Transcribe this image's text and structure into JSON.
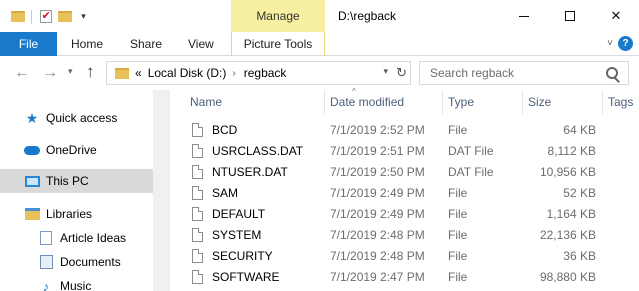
{
  "titlebar": {
    "manage_label": "Manage",
    "window_title": "D:\\regback",
    "minimize": "minimize-icon",
    "maximize": "maximize-icon",
    "close_glyph": "✕"
  },
  "ribbon": {
    "file": "File",
    "tabs": [
      "Home",
      "Share",
      "View"
    ],
    "picture_tools": "Picture Tools",
    "help_glyph": "?"
  },
  "navbar": {
    "path_parts": [
      "Local Disk (D:)",
      "regback"
    ],
    "overflow": "«",
    "search_placeholder": "Search regback"
  },
  "sidebar": {
    "items": [
      {
        "label": "Quick access",
        "icon": "star-icon"
      },
      {
        "label": "OneDrive",
        "icon": "cloud-icon"
      },
      {
        "label": "This PC",
        "icon": "computer-icon"
      },
      {
        "label": "Libraries",
        "icon": "library-icon"
      },
      {
        "label": "Article Ideas",
        "icon": "document-icon"
      },
      {
        "label": "Documents",
        "icon": "documents-icon"
      },
      {
        "label": "Music",
        "icon": "music-icon"
      }
    ]
  },
  "filelist": {
    "columns": [
      "Name",
      "Date modified",
      "Type",
      "Size",
      "Tags"
    ],
    "rows": [
      {
        "name": "BCD",
        "date": "7/1/2019 2:52 PM",
        "type": "File",
        "size": "64 KB"
      },
      {
        "name": "USRCLASS.DAT",
        "date": "7/1/2019 2:51 PM",
        "type": "DAT File",
        "size": "8,112 KB"
      },
      {
        "name": "NTUSER.DAT",
        "date": "7/1/2019 2:50 PM",
        "type": "DAT File",
        "size": "10,956 KB"
      },
      {
        "name": "SAM",
        "date": "7/1/2019 2:49 PM",
        "type": "File",
        "size": "52 KB"
      },
      {
        "name": "DEFAULT",
        "date": "7/1/2019 2:49 PM",
        "type": "File",
        "size": "1,164 KB"
      },
      {
        "name": "SYSTEM",
        "date": "7/1/2019 2:48 PM",
        "type": "File",
        "size": "22,136 KB"
      },
      {
        "name": "SECURITY",
        "date": "7/1/2019 2:48 PM",
        "type": "File",
        "size": "36 KB"
      },
      {
        "name": "SOFTWARE",
        "date": "7/1/2019 2:47 PM",
        "type": "File",
        "size": "98,880 KB"
      }
    ]
  },
  "colors": {
    "accent": "#1979ca",
    "manage_bg": "#f7f0a0",
    "selected_bg": "#d9d9d9",
    "header_text": "#4c607a"
  }
}
